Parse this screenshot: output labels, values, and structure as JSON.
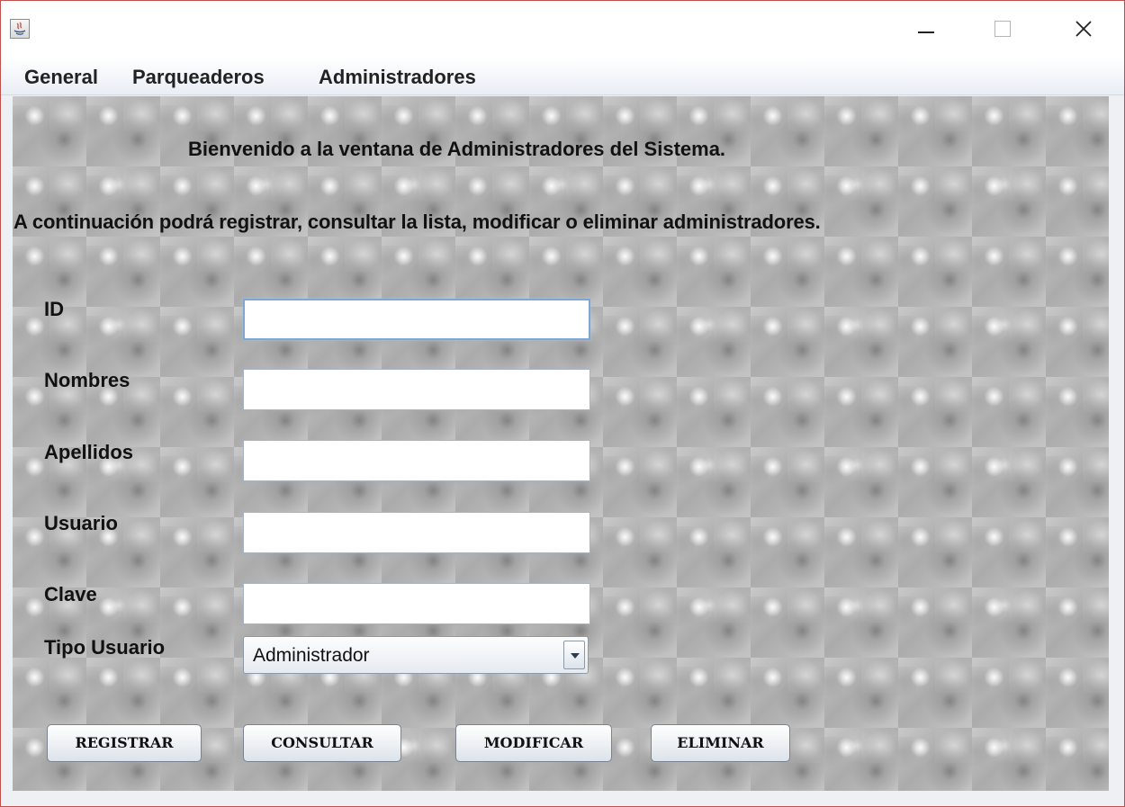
{
  "window": {
    "menu": [
      "General",
      "Parqueaderos",
      "Administradores"
    ]
  },
  "content": {
    "welcome": "Bienvenido a la ventana de Administradores del Sistema.",
    "instructions": "A continuación podrá registrar, consultar la lista, modificar o eliminar administradores."
  },
  "form": {
    "id_label": "ID",
    "id_value": "",
    "nombres_label": "Nombres",
    "nombres_value": "",
    "apellidos_label": "Apellidos",
    "apellidos_value": "",
    "usuario_label": "Usuario",
    "usuario_value": "",
    "clave_label": "Clave",
    "clave_value": "",
    "tipo_label": "Tipo Usuario",
    "tipo_selected": "Administrador"
  },
  "buttons": {
    "registrar": "REGISTRAR",
    "consultar": "CONSULTAR",
    "modificar": "MODIFICAR",
    "eliminar": "ELIMINAR"
  },
  "icons": {
    "app": "java-app-icon",
    "minimize": "minimize-icon",
    "maximize": "maximize-icon",
    "close": "close-icon",
    "dropdown": "chevron-down-icon"
  },
  "colors": {
    "window_border": "#c0504d",
    "focus_border": "#7fa6d4",
    "background_texture": "#b8b8b8"
  }
}
